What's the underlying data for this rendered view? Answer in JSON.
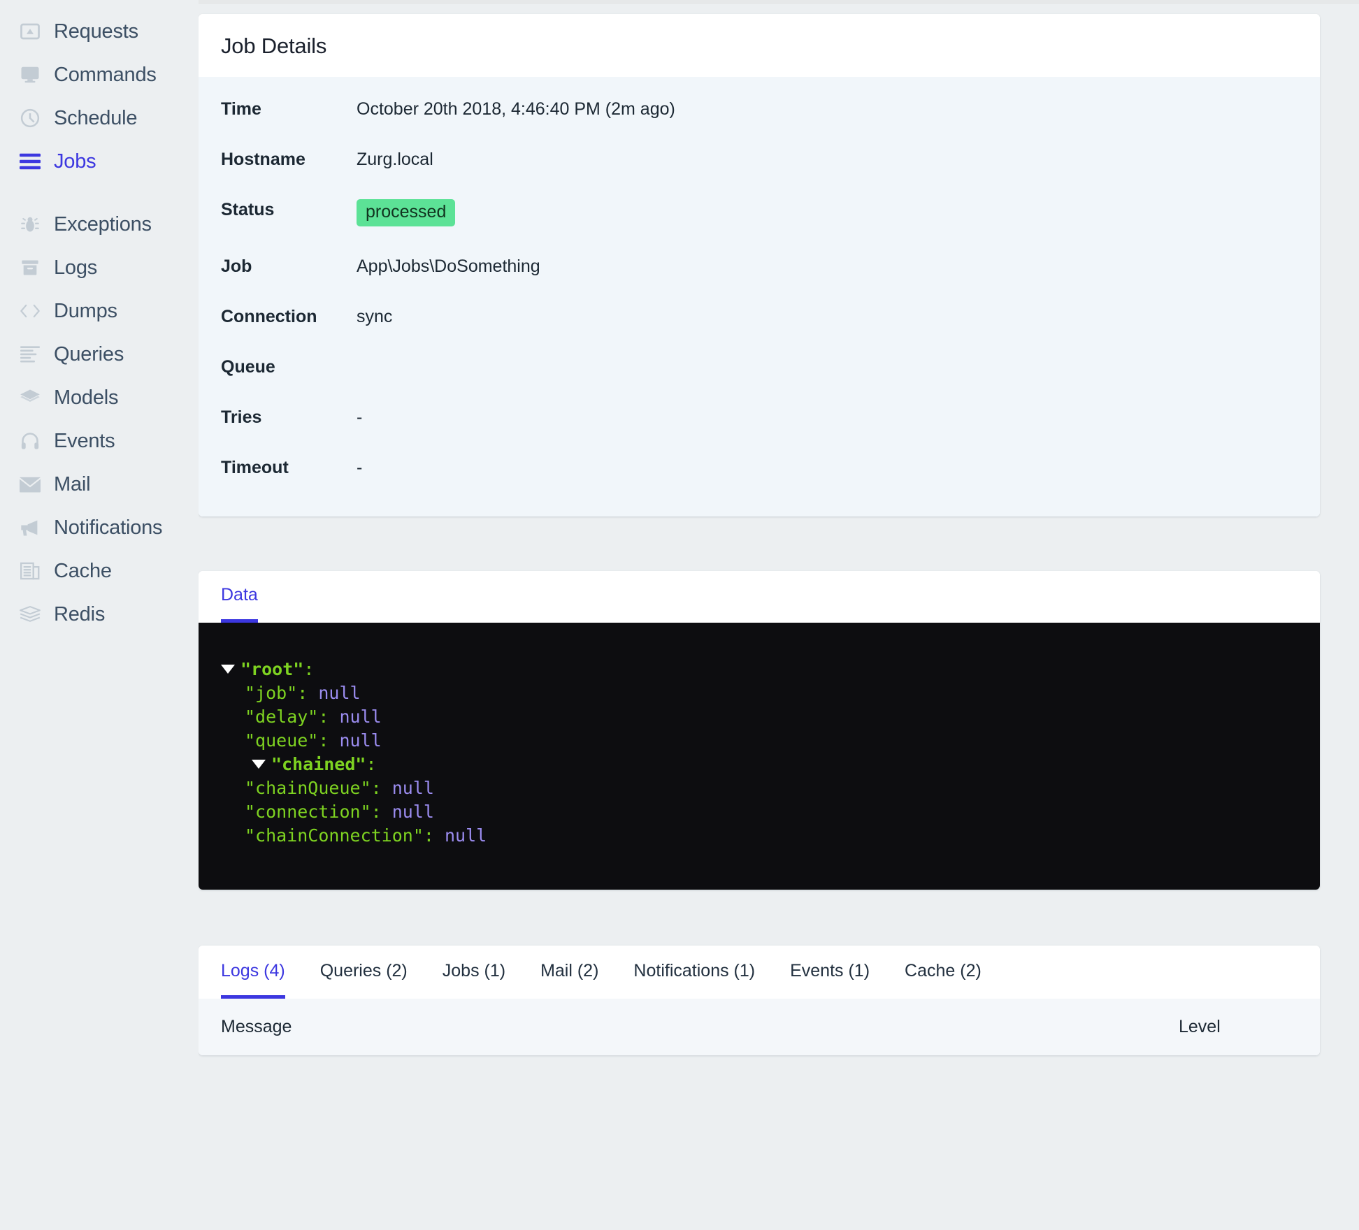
{
  "sidebar": {
    "groups": [
      {
        "items": [
          {
            "label": "Requests",
            "icon": "requests-icon",
            "active": false
          },
          {
            "label": "Commands",
            "icon": "commands-icon",
            "active": false
          },
          {
            "label": "Schedule",
            "icon": "schedule-clock-icon",
            "active": false
          },
          {
            "label": "Jobs",
            "icon": "jobs-lines-icon",
            "active": true
          }
        ]
      },
      {
        "items": [
          {
            "label": "Exceptions",
            "icon": "bug-icon",
            "active": false
          },
          {
            "label": "Logs",
            "icon": "archive-icon",
            "active": false
          },
          {
            "label": "Dumps",
            "icon": "code-brackets-icon",
            "active": false
          },
          {
            "label": "Queries",
            "icon": "text-lines-icon",
            "active": false
          },
          {
            "label": "Models",
            "icon": "layers-icon",
            "active": false
          },
          {
            "label": "Events",
            "icon": "headphones-icon",
            "active": false
          },
          {
            "label": "Mail",
            "icon": "envelope-icon",
            "active": false
          },
          {
            "label": "Notifications",
            "icon": "megaphone-icon",
            "active": false
          },
          {
            "label": "Cache",
            "icon": "newspaper-icon",
            "active": false
          },
          {
            "label": "Redis",
            "icon": "stack-icon",
            "active": false
          }
        ]
      }
    ]
  },
  "job_details": {
    "title": "Job Details",
    "rows": [
      {
        "label": "Time",
        "value": "October 20th 2018, 4:46:40 PM (2m ago)",
        "type": "text"
      },
      {
        "label": "Hostname",
        "value": "Zurg.local",
        "type": "text"
      },
      {
        "label": "Status",
        "value": "processed",
        "type": "badge"
      },
      {
        "label": "Job",
        "value": "App\\Jobs\\DoSomething",
        "type": "text"
      },
      {
        "label": "Connection",
        "value": "sync",
        "type": "text"
      },
      {
        "label": "Queue",
        "value": "",
        "type": "text"
      },
      {
        "label": "Tries",
        "value": "-",
        "type": "text"
      },
      {
        "label": "Timeout",
        "value": "-",
        "type": "text"
      }
    ],
    "status_badge_color": "#5ce296"
  },
  "data_panel": {
    "tabs": [
      {
        "label": "Data",
        "active": true
      }
    ],
    "json_lines": [
      {
        "indent": 0,
        "caret": true,
        "key": "\"root\"",
        "bold": true,
        "value": null
      },
      {
        "indent": 1,
        "caret": false,
        "key": "\"job\"",
        "bold": false,
        "value": "null"
      },
      {
        "indent": 1,
        "caret": false,
        "key": "\"delay\"",
        "bold": false,
        "value": "null"
      },
      {
        "indent": 1,
        "caret": false,
        "key": "\"queue\"",
        "bold": false,
        "value": "null"
      },
      {
        "indent": 1,
        "caret": true,
        "key": "\"chained\"",
        "bold": true,
        "value": null
      },
      {
        "indent": 1,
        "caret": false,
        "key": "\"chainQueue\"",
        "bold": false,
        "value": "null"
      },
      {
        "indent": 1,
        "caret": false,
        "key": "\"connection\"",
        "bold": false,
        "value": "null"
      },
      {
        "indent": 1,
        "caret": false,
        "key": "\"chainConnection\"",
        "bold": false,
        "value": "null"
      }
    ],
    "key_color": "#7ed321",
    "null_color": "#9b8cf0",
    "background": "#0d0d10"
  },
  "related_entries": {
    "tabs": [
      {
        "label": "Logs (4)",
        "active": true
      },
      {
        "label": "Queries (2)",
        "active": false
      },
      {
        "label": "Jobs (1)",
        "active": false
      },
      {
        "label": "Mail (2)",
        "active": false
      },
      {
        "label": "Notifications (1)",
        "active": false
      },
      {
        "label": "Events (1)",
        "active": false
      },
      {
        "label": "Cache (2)",
        "active": false
      }
    ],
    "columns": {
      "message": "Message",
      "level": "Level"
    }
  },
  "theme": {
    "accent": "#3c37e0",
    "page_background": "#eceff1",
    "panel_background": "#f1f6fa"
  }
}
